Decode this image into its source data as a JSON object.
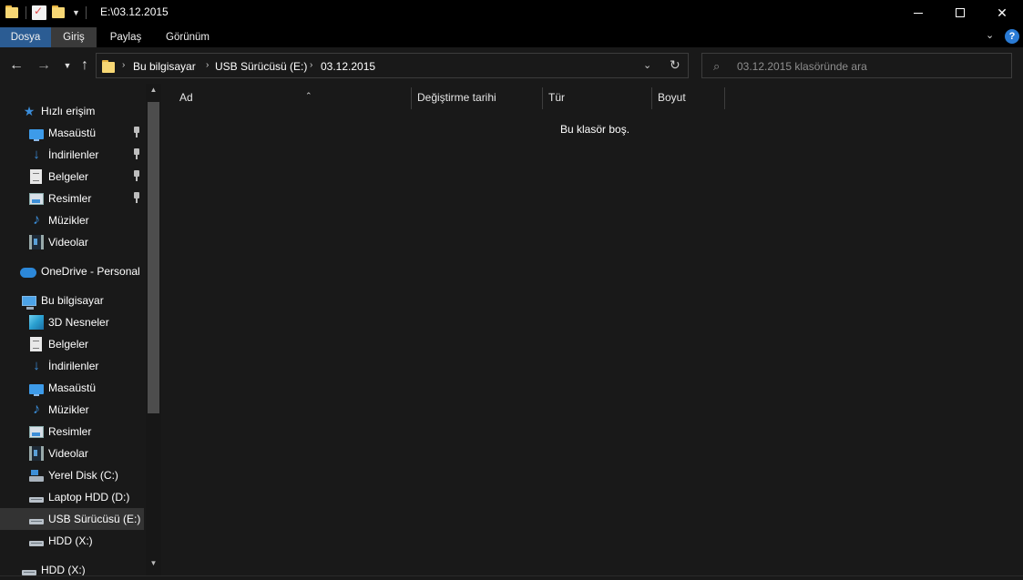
{
  "window": {
    "title": "E:\\03.12.2015"
  },
  "ribbon": {
    "tabs": [
      {
        "label": "Dosya"
      },
      {
        "label": "Giriş"
      },
      {
        "label": "Paylaş"
      },
      {
        "label": "Görünüm"
      }
    ]
  },
  "address": {
    "crumbs": [
      "Bu bilgisayar",
      "USB Sürücüsü (E:)",
      "03.12.2015"
    ]
  },
  "search": {
    "placeholder": "03.12.2015 klasöründe ara"
  },
  "nav": {
    "items": [
      {
        "label": "Hızlı erişim",
        "icon": "star-icon"
      },
      {
        "label": "Masaüstü",
        "icon": "desktop-icon",
        "pinned": true
      },
      {
        "label": "İndirilenler",
        "icon": "downloads-icon",
        "pinned": true
      },
      {
        "label": "Belgeler",
        "icon": "documents-icon",
        "pinned": true
      },
      {
        "label": "Resimler",
        "icon": "pictures-icon",
        "pinned": true
      },
      {
        "label": "Müzikler",
        "icon": "music-icon"
      },
      {
        "label": "Videolar",
        "icon": "videos-icon"
      },
      {
        "label": "OneDrive - Personal",
        "icon": "onedrive-icon"
      },
      {
        "label": "Bu bilgisayar",
        "icon": "this-pc-icon"
      },
      {
        "label": "3D Nesneler",
        "icon": "3d-objects-icon"
      },
      {
        "label": "Belgeler",
        "icon": "documents-icon"
      },
      {
        "label": "İndirilenler",
        "icon": "downloads-icon"
      },
      {
        "label": "Masaüstü",
        "icon": "desktop-icon"
      },
      {
        "label": "Müzikler",
        "icon": "music-icon"
      },
      {
        "label": "Resimler",
        "icon": "pictures-icon"
      },
      {
        "label": "Videolar",
        "icon": "videos-icon"
      },
      {
        "label": "Yerel Disk (C:)",
        "icon": "system-drive-icon"
      },
      {
        "label": "Laptop HDD (D:)",
        "icon": "drive-icon"
      },
      {
        "label": "USB Sürücüsü (E:)",
        "icon": "drive-icon",
        "selected": true
      },
      {
        "label": "HDD (X:)",
        "icon": "drive-icon"
      },
      {
        "label": "HDD (X:)",
        "icon": "drive-icon"
      }
    ]
  },
  "content": {
    "columns": [
      {
        "label": "Ad"
      },
      {
        "label": "Değiştirme tarihi"
      },
      {
        "label": "Tür"
      },
      {
        "label": "Boyut"
      }
    ],
    "empty_message": "Bu klasör boş."
  },
  "colors": {
    "accent_tab": "#2b5c93",
    "background": "#191919",
    "titlebar": "#000000"
  }
}
